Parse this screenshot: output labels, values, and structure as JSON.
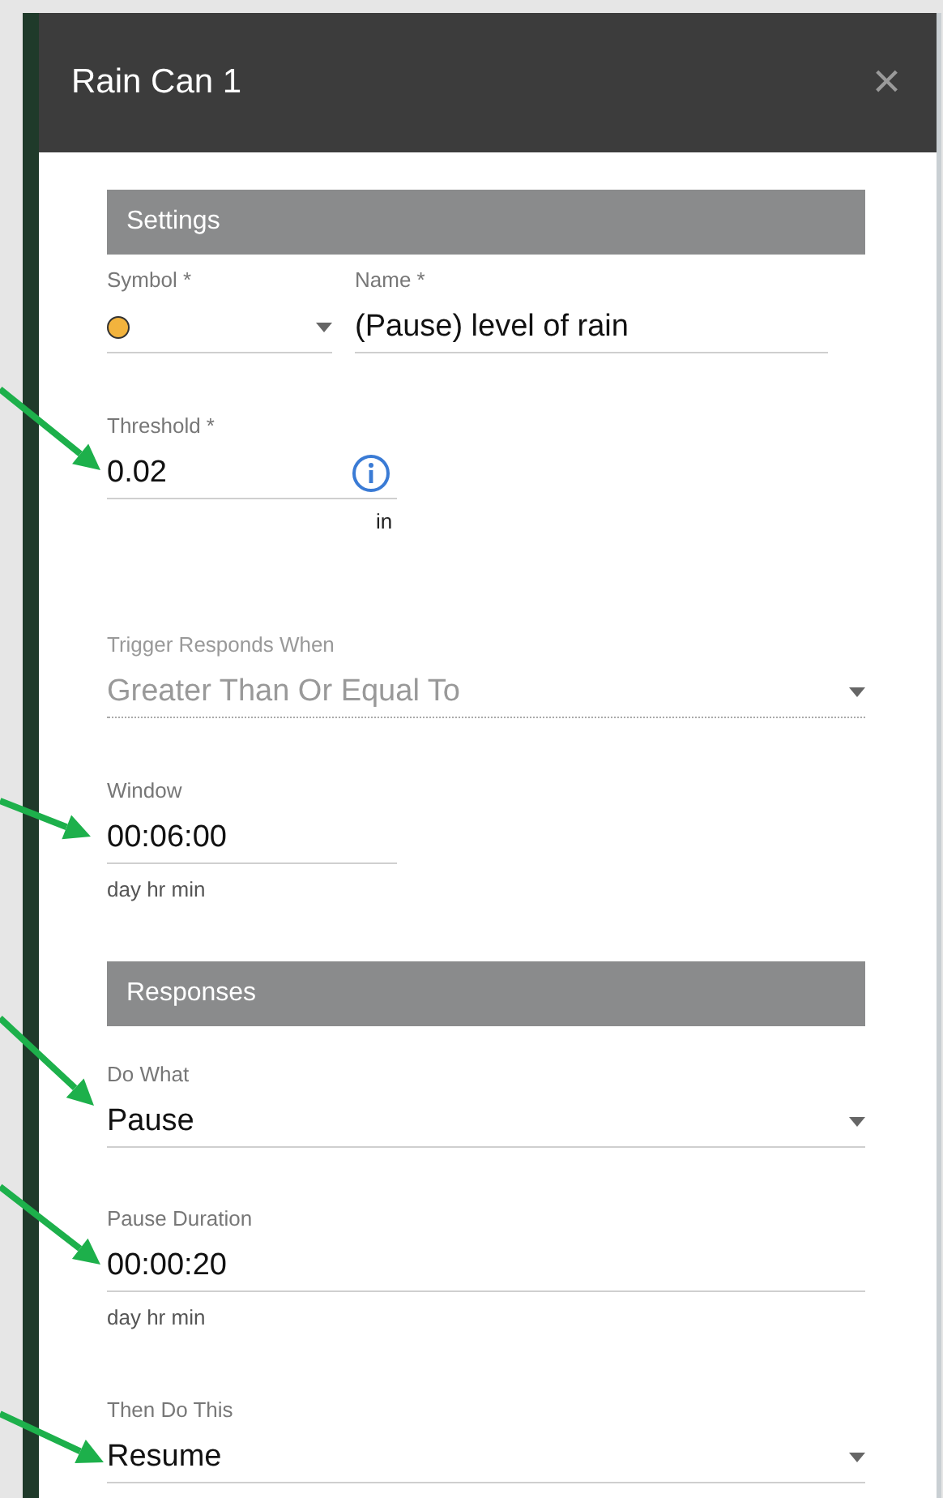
{
  "dialog": {
    "title": "Rain Can 1",
    "close": "×"
  },
  "sections": [
    {
      "title": "Settings",
      "rows": [
        [
          {
            "kind": "symbol",
            "label": "Symbol *",
            "color": "#f2b33d",
            "disabled": false
          },
          {
            "kind": "text",
            "label": "Name *",
            "value": "(Pause) level of rain"
          }
        ],
        [
          {
            "kind": "number",
            "label": "Threshold *",
            "value": "0.02",
            "unit": "in"
          }
        ],
        [
          {
            "kind": "select",
            "label": "Trigger Responds When",
            "value": "Greater Than Or Equal To",
            "disabled": true
          }
        ],
        [
          {
            "kind": "duration",
            "label": "Window",
            "value": "00:06:00",
            "hint": "day hr min",
            "wide": false
          }
        ]
      ]
    },
    {
      "title": "Responses",
      "rows": [
        [
          {
            "kind": "select",
            "label": "Do What",
            "value": "Pause",
            "disabled": false
          }
        ],
        [
          {
            "kind": "duration",
            "label": "Pause Duration",
            "value": "00:00:20",
            "hint": "day hr min",
            "wide": true
          }
        ],
        [
          {
            "kind": "select",
            "label": "Then Do This",
            "value": "Resume",
            "disabled": false
          }
        ]
      ]
    }
  ]
}
